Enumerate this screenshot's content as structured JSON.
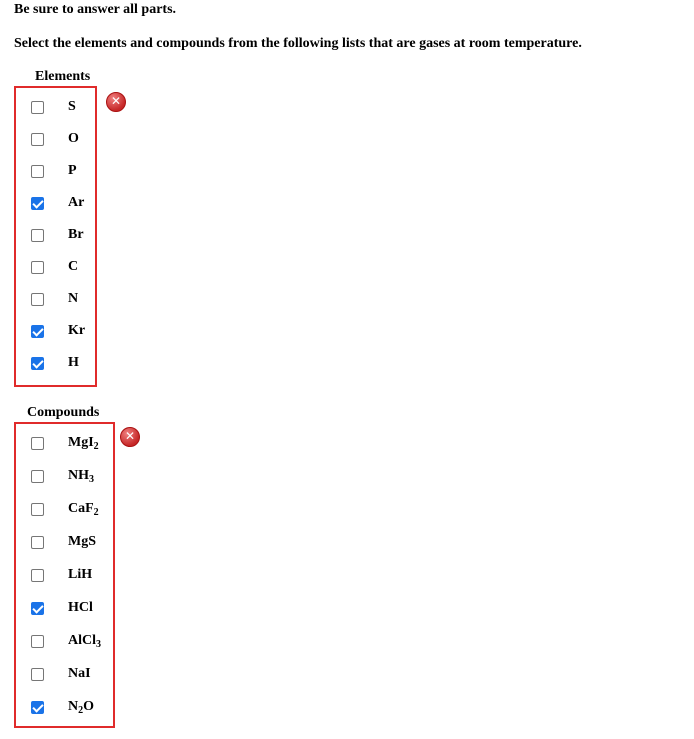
{
  "instructions": {
    "line1": "Be sure to answer all parts.",
    "line2": "Select the elements and compounds from the following lists that are gases at room temperature."
  },
  "elements": {
    "title": "Elements",
    "result_icon": "incorrect-x-icon",
    "items": [
      {
        "label": "S",
        "checked": false
      },
      {
        "label": "O",
        "checked": false
      },
      {
        "label": "P",
        "checked": false
      },
      {
        "label": "Ar",
        "checked": true
      },
      {
        "label": "Br",
        "checked": false
      },
      {
        "label": "C",
        "checked": false
      },
      {
        "label": "N",
        "checked": false
      },
      {
        "label": "Kr",
        "checked": true
      },
      {
        "label": "H",
        "checked": true
      }
    ]
  },
  "compounds": {
    "title": "Compounds",
    "result_icon": "incorrect-x-icon",
    "items": [
      {
        "label": "MgI₂",
        "parts": [
          [
            "MgI",
            ""
          ],
          [
            "2",
            "sub"
          ]
        ],
        "checked": false
      },
      {
        "label": "NH₃",
        "parts": [
          [
            "NH",
            ""
          ],
          [
            "3",
            "sub"
          ]
        ],
        "checked": false
      },
      {
        "label": "CaF₂",
        "parts": [
          [
            "CaF",
            ""
          ],
          [
            "2",
            "sub"
          ]
        ],
        "checked": false
      },
      {
        "label": "MgS",
        "parts": [
          [
            "MgS",
            ""
          ]
        ],
        "checked": false
      },
      {
        "label": "LiH",
        "parts": [
          [
            "LiH",
            ""
          ]
        ],
        "checked": false
      },
      {
        "label": "HCl",
        "parts": [
          [
            "HCl",
            ""
          ]
        ],
        "checked": true
      },
      {
        "label": "AlCl₃",
        "parts": [
          [
            "AlCl",
            ""
          ],
          [
            "3",
            "sub"
          ]
        ],
        "checked": false
      },
      {
        "label": "NaI",
        "parts": [
          [
            "NaI",
            ""
          ]
        ],
        "checked": false
      },
      {
        "label": "N₂O",
        "parts": [
          [
            "N",
            ""
          ],
          [
            "2",
            "sub"
          ],
          [
            "O",
            ""
          ]
        ],
        "checked": true
      }
    ]
  },
  "colors": {
    "box_border": "#e02b2b",
    "checkbox_checked": "#1a73e8"
  }
}
